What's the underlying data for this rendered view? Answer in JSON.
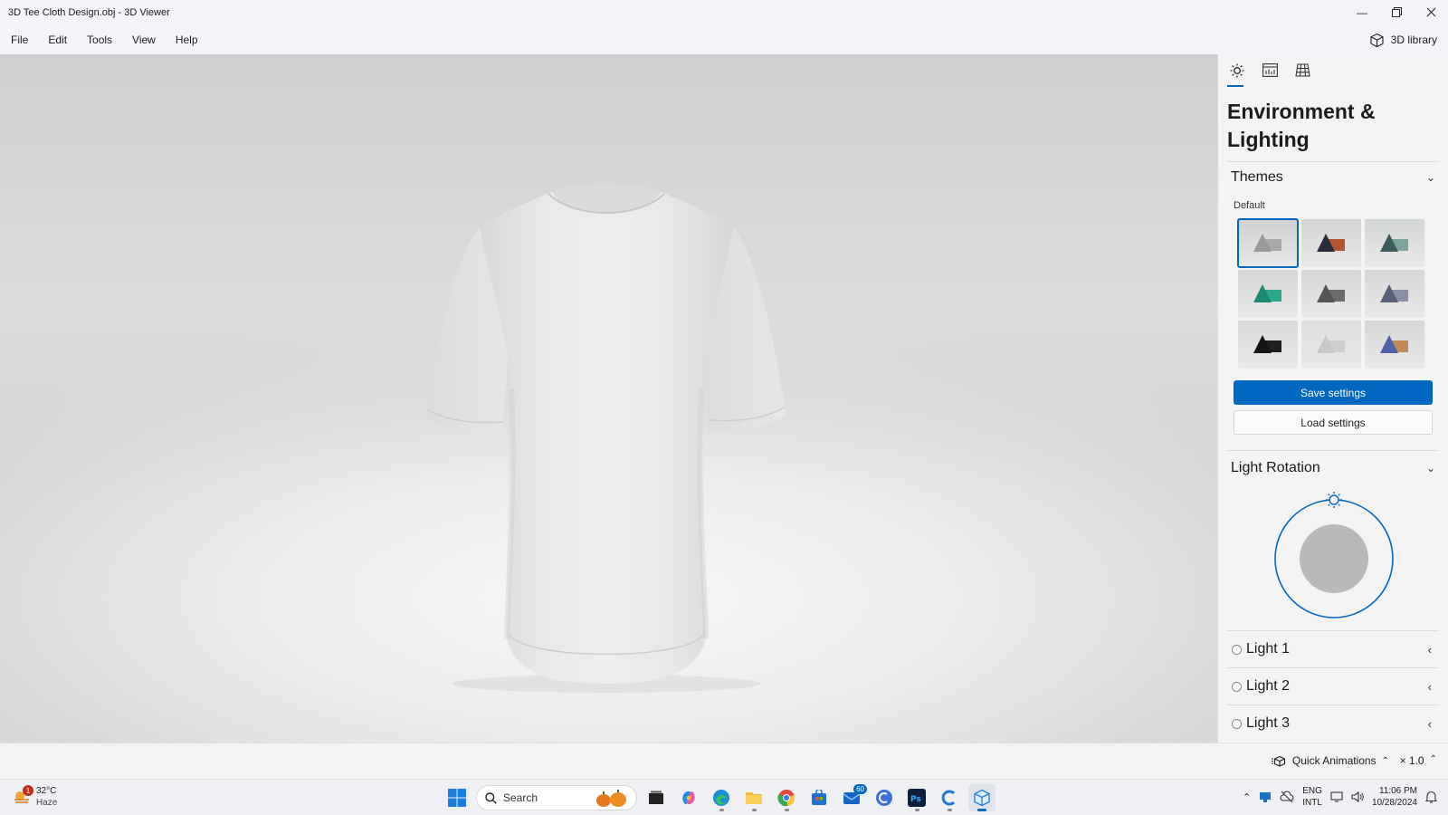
{
  "window": {
    "title": "3D Tee Cloth Design.obj - 3D Viewer",
    "minimize_icon": "minimize-icon",
    "restore_icon": "restore-icon",
    "close_icon": "close-icon"
  },
  "menu": {
    "items": [
      "File",
      "Edit",
      "Tools",
      "View",
      "Help"
    ],
    "library_label": "3D library"
  },
  "panel": {
    "tabs": [
      "sun-icon",
      "stats-icon",
      "grid-icon"
    ],
    "active_tab": 0,
    "title": "Environment & Lighting",
    "themes": {
      "heading": "Themes",
      "sub_label": "Default",
      "selected_index": 0,
      "swatches": [
        {
          "bg": "#cfcfcf",
          "cone": "#9a9a9a",
          "box": "#a8a8a8"
        },
        {
          "bg": "#d4d4d4",
          "cone": "#2b2d3f",
          "box": "#b4542e"
        },
        {
          "bg": "#d3d6d6",
          "cone": "#3d5a5c",
          "box": "#7fa39d"
        },
        {
          "bg": "#d6d6d6",
          "cone": "#1e8a76",
          "box": "#2aa889"
        },
        {
          "bg": "#d6d6d6",
          "cone": "#555555",
          "box": "#6b6b6b"
        },
        {
          "bg": "#d6d6d6",
          "cone": "#5a5f7a",
          "box": "#8a8fa6"
        },
        {
          "bg": "#d9d9d9",
          "cone": "#151515",
          "box": "#1f1f1f"
        },
        {
          "bg": "#dedede",
          "cone": "#c8c8c8",
          "box": "#cfcfcf"
        },
        {
          "bg": "#d6d6d6",
          "cone": "#5163a8",
          "box": "#c08a5a"
        }
      ],
      "save_label": "Save settings",
      "load_label": "Load settings"
    },
    "light_rotation": {
      "heading": "Light Rotation"
    },
    "lights": [
      "Light 1",
      "Light 2",
      "Light 3"
    ]
  },
  "status": {
    "animations_label": "Quick Animations",
    "speed": "× 1.0"
  },
  "taskbar": {
    "weather": {
      "temp": "32°C",
      "condition": "Haze",
      "badge": "1"
    },
    "search_placeholder": "Search",
    "mail_badge": "60",
    "tray": {
      "lang1": "ENG",
      "lang2": "INTL",
      "time": "11:06 PM",
      "date": "10/28/2024"
    }
  },
  "colors": {
    "accent": "#0067c0"
  }
}
